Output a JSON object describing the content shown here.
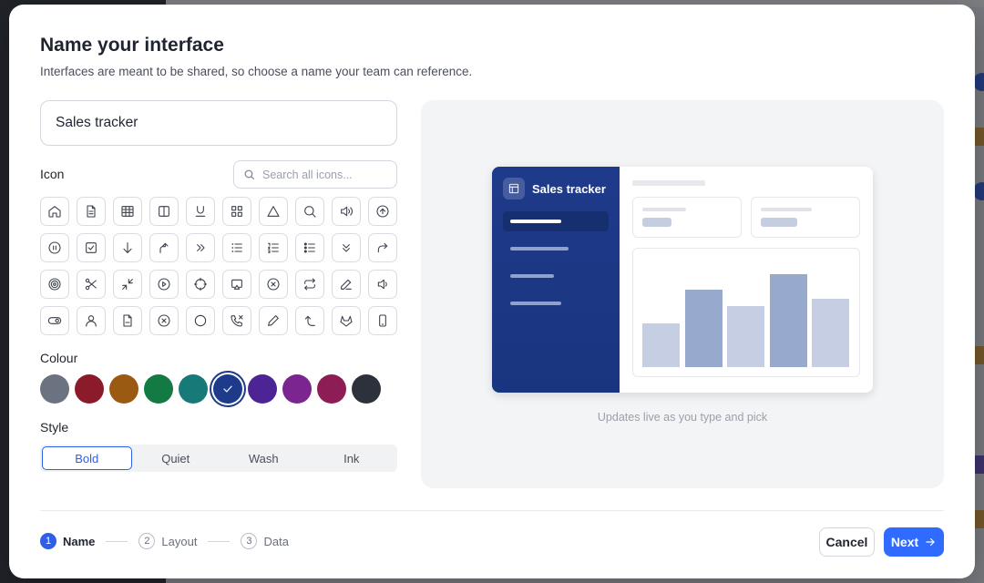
{
  "dialog": {
    "title": "Name your interface",
    "subtitle": "Interfaces are meant to be shared, so choose a name your team can reference.",
    "name_value": "Sales tracker"
  },
  "icon_section": {
    "label": "Icon",
    "search_placeholder": "Search all icons...",
    "icons": [
      "home-icon",
      "document-icon",
      "table-icon",
      "columns-icon",
      "underline-icon",
      "grid-icon",
      "triangle-icon",
      "search-icon",
      "volume-icon",
      "arrow-up-circle-icon",
      "pause-circle-icon",
      "checkbox-icon",
      "arrow-down-icon",
      "turn-up-right-icon",
      "chevrons-right-icon",
      "list-icon",
      "ordered-list-icon",
      "bullet-list-icon",
      "chevrons-down-icon",
      "redo-icon",
      "target-icon",
      "scissors-icon",
      "minimize-icon",
      "play-circle-icon",
      "crosshair-icon",
      "cast-icon",
      "x-circle-icon",
      "repeat-icon",
      "pen-icon",
      "speaker-icon",
      "toggle-icon",
      "user-icon",
      "file-icon",
      "x-circle-icon",
      "circle-icon",
      "phone-missed-icon",
      "pencil-icon",
      "corner-up-left-icon",
      "gitlab-icon",
      "smartphone-icon"
    ]
  },
  "colour_section": {
    "label": "Colour",
    "swatches": [
      "#6b7280",
      "#8b1a2b",
      "#9a5a12",
      "#137a43",
      "#187a78",
      "#1e3a8a",
      "#4c2496",
      "#7a2590",
      "#8c1d55",
      "#2d313b"
    ],
    "selected_index": 5
  },
  "style_section": {
    "label": "Style",
    "options": [
      "Bold",
      "Quiet",
      "Wash",
      "Ink"
    ],
    "selected": "Bold"
  },
  "preview": {
    "app_name": "Sales tracker",
    "caption": "Updates live as you type and pick",
    "bar_levels": [
      0.46,
      0.82,
      0.64,
      0.98,
      0.72
    ],
    "bar_colors": [
      "#c5cee3",
      "#98a9ce",
      "#c5cee3",
      "#98a9ce",
      "#c5cee3"
    ]
  },
  "footer": {
    "steps": [
      {
        "num": "1",
        "label": "Name"
      },
      {
        "num": "2",
        "label": "Layout"
      },
      {
        "num": "3",
        "label": "Data"
      }
    ],
    "cancel_label": "Cancel",
    "next_label": "Next"
  }
}
